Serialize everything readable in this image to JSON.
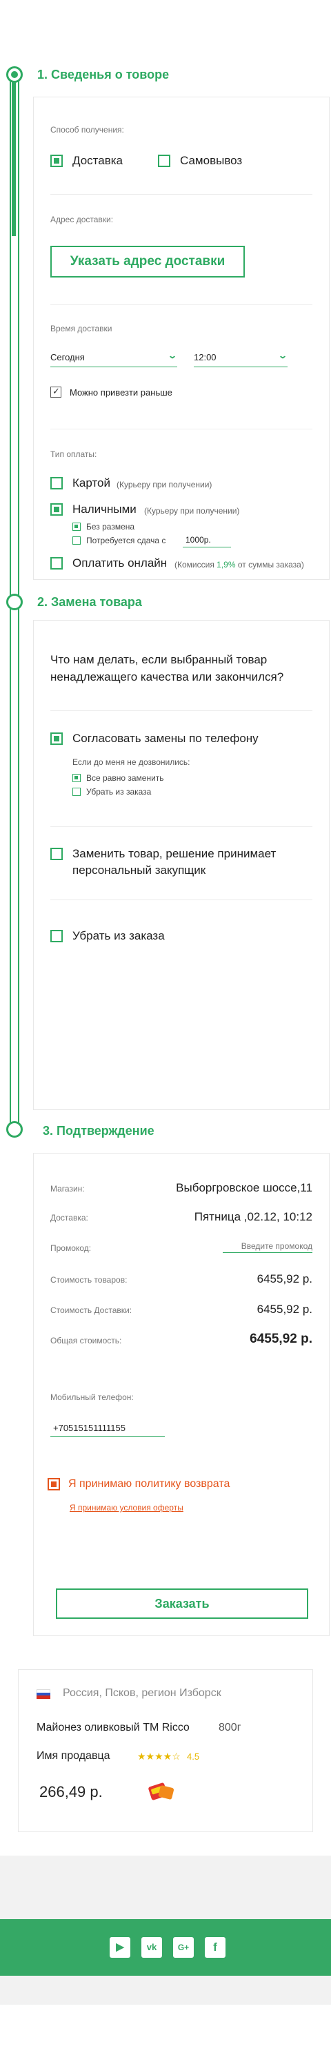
{
  "section1": {
    "title": "1. Сведенья о товоре",
    "receive_label": "Способ получения:",
    "delivery_option": "Доставка",
    "pickup_option": "Самовывоз",
    "address_label": "Адрес доставки:",
    "address_button": "Указать адрес доставки",
    "time_label": "Время доставки",
    "day_value": "Сегодня",
    "time_value": "12:00",
    "earlier_label": "Можно привезти раньше",
    "payment_label": "Тип оплаты:",
    "card_option": "Картой",
    "card_hint": "(Курьеру при получении)",
    "cash_option": "Наличными",
    "cash_hint": "(Курьеру при получении)",
    "no_change": "Без размена",
    "change_needed": "Потребуется сдача с",
    "change_amount": "1000р.",
    "online_option": "Оплатить онлайн",
    "online_hint_prefix": "(Комиссия ",
    "online_hint_percent": "1,9%",
    "online_hint_suffix": " от суммы заказа)"
  },
  "section2": {
    "title": "2. Замена товара",
    "question": "Что нам делать, если выбранный товар ненадлежащего качества или закончился?",
    "option_phone": "Согласовать замены по телефону",
    "unreachable_label": "Если до меня не дозвонились:",
    "sub_replace": "Все равно заменить",
    "sub_remove": "Убрать из заказа",
    "option_shopper": "Заменить товар, решение принимает персональный закупщик",
    "option_remove": "Убрать из заказа"
  },
  "section3": {
    "title": "3. Подтверждение",
    "rows": [
      {
        "label": "Магазин:",
        "value": "Выборгровское шоссе,11"
      },
      {
        "label": "Доставка:",
        "value": "Пятница ,02.12, 10:12"
      },
      {
        "label": "Промокод:",
        "value": ""
      },
      {
        "label": "Стоимость товаров:",
        "value": "6455,92 р."
      },
      {
        "label": "Стоимость Доставки:",
        "value": "6455,92 р."
      },
      {
        "label": "Общая стоимость:",
        "value": "6455,92 р."
      }
    ],
    "promo_placeholder": "Введите промокод",
    "phone_label": "Мобильный телефон:",
    "phone_value": "+70515151111155",
    "accept_policy": "Я принимаю политику возврата",
    "accept_offer": "Я принимаю условия оферты",
    "order_button": "Заказать"
  },
  "product": {
    "region": "Россия, Псков, регион Изборск",
    "name": "Майонез оливковый ТМ Ricco",
    "weight": "800г",
    "seller": "Имя продавца",
    "stars": "★★★★☆",
    "rating": "4.5",
    "price": "266,49 р."
  },
  "footer": {
    "icons": [
      "youtube-icon",
      "vk-icon",
      "google-plus-icon",
      "facebook-icon"
    ]
  },
  "colors": {
    "accent": "#2eaa62",
    "warning": "#e5541b",
    "footer": "#35a865"
  }
}
